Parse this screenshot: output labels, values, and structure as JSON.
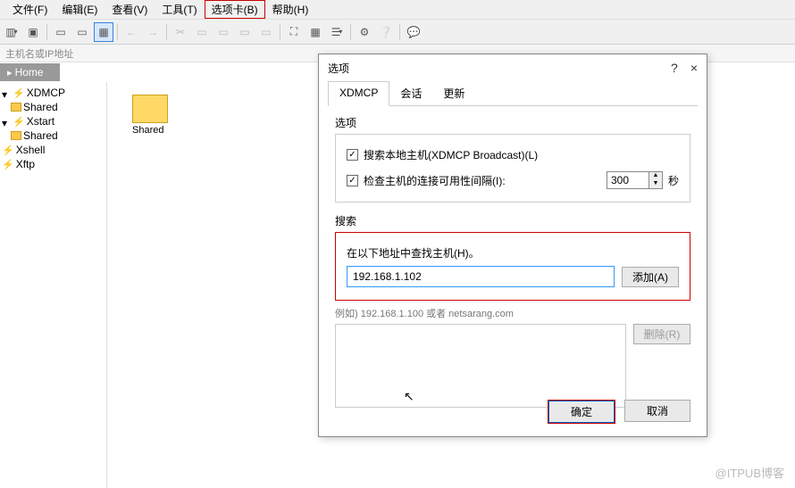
{
  "menubar": {
    "file": "文件(F)",
    "edit": "编辑(E)",
    "view": "查看(V)",
    "tools": "工具(T)",
    "tabs": "选项卡(B)",
    "help": "帮助(H)"
  },
  "addrbar": {
    "placeholder": "主机名或IP地址"
  },
  "breadcrumb": {
    "home": "Home"
  },
  "tree": {
    "items": [
      {
        "label": "XDMCP",
        "level": 0
      },
      {
        "label": "Shared",
        "level": 1
      },
      {
        "label": "Xstart",
        "level": 0
      },
      {
        "label": "Shared",
        "level": 1
      },
      {
        "label": "Xshell",
        "level": 0
      },
      {
        "label": "Xftp",
        "level": 0
      }
    ]
  },
  "content": {
    "folder_label": "Shared"
  },
  "dialog": {
    "title": "选项",
    "help": "?",
    "close": "×",
    "tabs": {
      "xdmcp": "XDMCP",
      "session": "会话",
      "update": "更新"
    },
    "options_group": {
      "title": "选项",
      "chk_broadcast": "搜索本地主机(XDMCP Broadcast)(L)",
      "chk_interval": "检查主机的连接可用性间隔(I):",
      "interval_value": "300",
      "interval_unit": "秒"
    },
    "search_group": {
      "title": "搜索",
      "label": "在以下地址中查找主机(H)。",
      "host_value": "192.168.1.102",
      "add_btn": "添加(A)",
      "example": "例如) 192.168.1.100 或者 netsarang.com",
      "remove_btn": "删除(R)"
    },
    "ok": "确定",
    "cancel": "取消"
  },
  "watermark": "@ITPUB博客"
}
